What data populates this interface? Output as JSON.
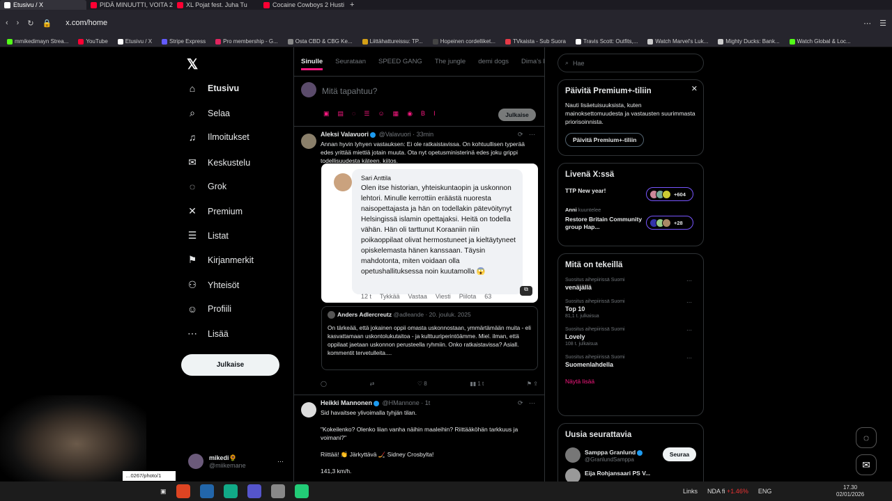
{
  "browser": {
    "tabs": [
      {
        "label": "Etusivu / X",
        "color": "#ffffff"
      },
      {
        "label": "PIDÄ MINUUTTI, VOITA 20",
        "color": "#ff0033"
      },
      {
        "label": "XL Pojat fest. Juha Tu",
        "color": "#ff0033"
      },
      {
        "label": "Cocaine Cowboys 2 Husti",
        "color": "#ff0033"
      }
    ],
    "url": "x.com/home",
    "bookmarks": [
      {
        "label": "mmikedimayn Strea...",
        "color": "#53fc18"
      },
      {
        "label": "YouTube",
        "color": "#ff0033"
      },
      {
        "label": "Etusivu / X",
        "color": "#ffffff"
      },
      {
        "label": "Stripe Express",
        "color": "#635bff"
      },
      {
        "label": "Pro membership - G...",
        "color": "#e0245e"
      },
      {
        "label": "Osta CBD & CBG Ke...",
        "color": "#888888"
      },
      {
        "label": "Liittähattureissu: TP...",
        "color": "#d4a017"
      },
      {
        "label": "Hopeinen cordelliket...",
        "color": "#444444"
      },
      {
        "label": "TVkaista - Sub Suora",
        "color": "#e63946"
      },
      {
        "label": "Travis Scott: Outfits,...",
        "color": "#ffffff"
      },
      {
        "label": "Watch Marvel's Luk...",
        "color": "#cccccc"
      },
      {
        "label": "Mighty Ducks: Bank...",
        "color": "#cccccc"
      },
      {
        "label": "Watch Global & Loc...",
        "color": "#53fc18"
      }
    ]
  },
  "nav": {
    "items": [
      {
        "label": "Etusivu",
        "icon": "home-icon",
        "glyph": "⌂"
      },
      {
        "label": "Selaa",
        "icon": "search-icon",
        "glyph": "⌕"
      },
      {
        "label": "Ilmoitukset",
        "icon": "bell-icon",
        "glyph": "♫"
      },
      {
        "label": "Keskustelu",
        "icon": "mail-icon",
        "glyph": "✉"
      },
      {
        "label": "Grok",
        "icon": "grok-icon",
        "glyph": "◌"
      },
      {
        "label": "Premium",
        "icon": "x-icon",
        "glyph": "✕"
      },
      {
        "label": "Listat",
        "icon": "list-icon",
        "glyph": "☰"
      },
      {
        "label": "Kirjanmerkit",
        "icon": "bookmark-icon",
        "glyph": "⚑"
      },
      {
        "label": "Yhteisöt",
        "icon": "communities-icon",
        "glyph": "⚇"
      },
      {
        "label": "Profiili",
        "icon": "profile-icon",
        "glyph": "☺"
      },
      {
        "label": "Lisää",
        "icon": "more-icon",
        "glyph": "⋯"
      }
    ],
    "post_button": "Julkaise",
    "account_name": "mikedi🌻",
    "account_handle": "@miikemane"
  },
  "feed": {
    "tabs": [
      "Sinulle",
      "Seurataan",
      "SPEED GANG",
      "The jungle",
      "demi dogs",
      "Dima's Di"
    ],
    "composer_placeholder": "Mitä tapahtuu?",
    "composer_button": "Julkaise",
    "tweet1": {
      "name": "Aleksi Valavuori",
      "handle": "@Valavuori",
      "time": "33min",
      "text": "Annan hyvin lyhyen vastauksen: Ei ole ratkaistavissa. On kohtuullisen typerää edes yrittää miettiä jotain muuta. Ota nyt opetusministerinä edes joku grippi todellisuudesta käteen. kiitos.",
      "image_name": "Sari Anttila",
      "image_text": "Olen itse historian, yhteiskuntaopin ja uskonnon lehtori. Minulle kerrottiin eräästä nuoresta naisopettajasta ja hän on todellakin pätevöitynyt Helsingissä islamin opettajaksi. Heitä on todella vähän. Hän oli tarttunut Koraaniin niin poikaoppilaat olivat hermostuneet ja kieltäytyneet opiskelemasta hänen kanssaan. Täysin mahdotonta, miten voidaan olla opetushallituksessa noin kuutamolla 😱",
      "image_actions": [
        "12 t",
        "Tykkää",
        "Vastaa",
        "Viesti",
        "Piilota",
        "63"
      ],
      "quote_name": "Anders Adlercreutz",
      "quote_handle": "@adleande",
      "quote_date": "20. jouluk. 2025",
      "quote_text": "On tärkeää, että jokainen oppii omasta uskonnostaan, ymmärtämään muita - eli kasvattamaan uskontolukutaitoa - ja kulttuuriperintöämme. Miel. ilman, että oppilaat jaetaan uskonnon perusteella ryhmiin. Onko ratkaistavissa? Asiall. kommentit tervetulleita....",
      "likes": "8",
      "views": "1 t"
    },
    "tweet2": {
      "name": "Heikki Mannonen",
      "handle": "@HMannone",
      "time": "1t",
      "line1": "Sid havaitsee ylivoimalla tyhjän tilan.",
      "line2": "\"Kokeilenko? Olenko liian vanha näihin maaleihin? Riittääköhän tarkkuus ja voimani?\"",
      "line3": "Riittää! 👏 Järkyttävä 🏒 Sidney Crosbylta!",
      "line4": "141,3 km/h."
    }
  },
  "right": {
    "search_placeholder": "Hae",
    "premium_title": "Päivitä Premium+-tiliin",
    "premium_text": "Nauti lisäetuisuuksista, kuten mainoksettomuudesta ja vastausten suurimmasta priorisoinnista.",
    "premium_button": "Päivitä Premium+-tiliin",
    "live_title": "Livenä X:ssä",
    "live1_title": "TTP New year!",
    "live1_count": "+604",
    "live2_listener": "Anni",
    "live2_listening": "kuuntelee",
    "live2_title": "Restore Britain Community group Hap...",
    "live2_count": "+28",
    "trends_title": "Mitä on tekeillä",
    "trends": [
      {
        "sub": "Suositus aihepiirissä Suomi",
        "name": "venäjällä",
        "count": ""
      },
      {
        "sub": "Suositus aihepiirissä Suomi",
        "name": "Top 10",
        "count": "81,1 t. julkaisua"
      },
      {
        "sub": "Suositus aihepiirissä Suomi",
        "name": "Lovely",
        "count": "108 t. julkaisua"
      },
      {
        "sub": "Suositus aihepiirissä Suomi",
        "name": "Suomenlahdella",
        "count": ""
      }
    ],
    "show_more": "Näytä lisää",
    "follow_title": "Uusia seurattavia",
    "follow1_name": "Samppa Granlund",
    "follow1_handle": "@GranlundSamppa",
    "follow_button": "Seuraa",
    "follow2_name": "Eija Rohjansaari PS V..."
  },
  "status_url": "…0267/photo/1",
  "taskbar": {
    "links": "Links",
    "stock": "NDA fi",
    "stock_change": "+1.46%",
    "lang": "ENG",
    "time": "17.30",
    "date": "02/01/2026"
  }
}
